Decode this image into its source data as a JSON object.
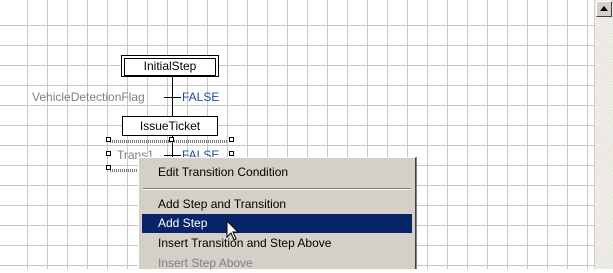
{
  "diagram": {
    "initial_step": "InitialStep",
    "transition1": {
      "label": "VehicleDetectionFlag",
      "condition": "FALSE"
    },
    "step2": "IssueTicket",
    "transition2": {
      "label": "Trans1",
      "condition": "FALSE"
    }
  },
  "context_menu": {
    "items": [
      {
        "label": "Edit Transition Condition",
        "state": "normal"
      },
      {
        "label": "Add Step and Transition",
        "state": "normal"
      },
      {
        "label": "Add Step",
        "state": "highlighted"
      },
      {
        "label": "Insert Transition and Step Above",
        "state": "normal"
      },
      {
        "label": "Insert Step Above",
        "state": "disabled"
      }
    ]
  },
  "scrollbar": {
    "up_arrow": "triangle-up-icon"
  },
  "cursor": "mouse-pointer-icon"
}
